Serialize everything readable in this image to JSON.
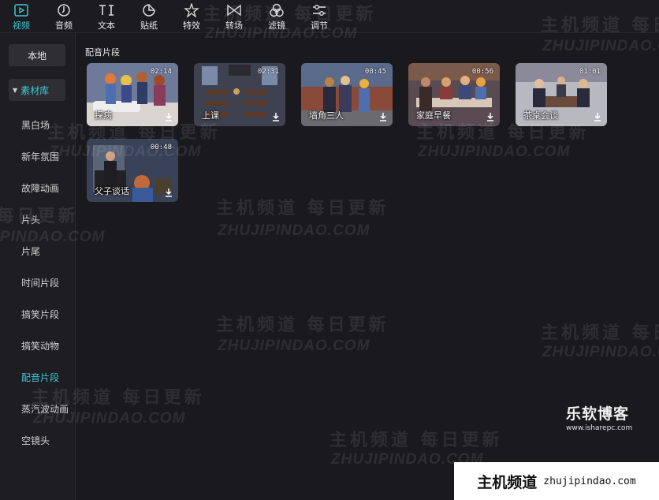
{
  "toolbar": [
    {
      "label": "视频",
      "icon": "video-icon",
      "active": true
    },
    {
      "label": "音频",
      "icon": "music-note-icon",
      "active": false
    },
    {
      "label": "文本",
      "icon": "text-icon",
      "active": false
    },
    {
      "label": "贴纸",
      "icon": "sticker-icon",
      "active": false
    },
    {
      "label": "特效",
      "icon": "effects-star-icon",
      "active": false
    },
    {
      "label": "转场",
      "icon": "transition-icon",
      "active": false
    },
    {
      "label": "滤镜",
      "icon": "filter-icon",
      "active": false
    },
    {
      "label": "调节",
      "icon": "adjust-sliders-icon",
      "active": false
    }
  ],
  "sidebar": {
    "local_label": "本地",
    "library_label": "素材库",
    "categories": [
      "黑白场",
      "新年氛围",
      "故障动画",
      "片头",
      "片尾",
      "时间片段",
      "搞笑片段",
      "搞笑动物",
      "配音片段",
      "蒸汽波动画",
      "空镜头"
    ],
    "active_category": "配音片段"
  },
  "section_title": "配音片段",
  "clips": [
    {
      "name": "探病",
      "duration": "02:14"
    },
    {
      "name": "上课",
      "duration": "02:31"
    },
    {
      "name": "墙角三人",
      "duration": "00:45"
    },
    {
      "name": "家庭早餐",
      "duration": "00:56"
    },
    {
      "name": "茶桌会谈",
      "duration": "01:01"
    },
    {
      "name": "父子谈话",
      "duration": "00:48"
    }
  ],
  "watermark": {
    "cn": "主机频道 每日更新",
    "en": "ZHUJIPINDAO.COM"
  },
  "brand": {
    "name": "乐软博客",
    "url": "www.isharepc.com"
  },
  "footer_badge": {
    "cn": "主机频道",
    "en": "zhujipindao.com"
  },
  "colors": {
    "accent": "#3cc8d4",
    "background": "#1a1a1e",
    "sidebar": "#1e1e22"
  }
}
